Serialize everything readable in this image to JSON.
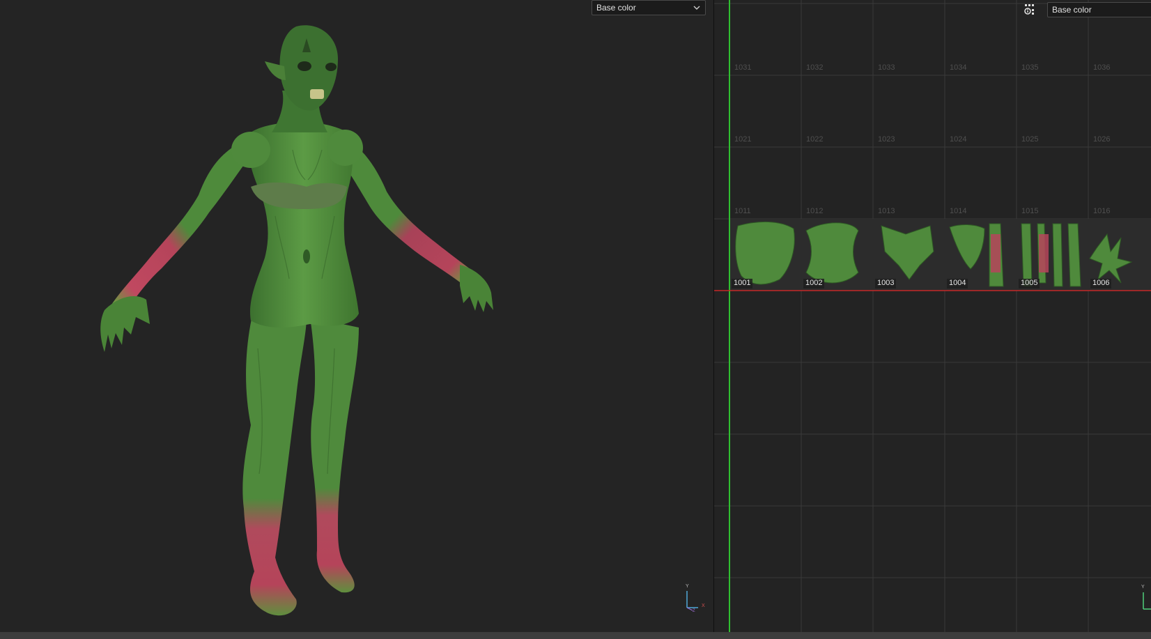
{
  "viewport3d": {
    "channel_select": {
      "value": "Base color"
    },
    "axis_gizmo": {
      "y_label": "Y",
      "x_label": "X",
      "z_label": "Z"
    }
  },
  "uv_view": {
    "channel_select": {
      "value": "Base color"
    },
    "info_icon": "viewer-settings-icon",
    "axis_gizmo": {
      "y_label": "Y"
    },
    "ghost_tiles": [
      "1031",
      "1032",
      "1033",
      "1034",
      "1035",
      "1036",
      "1021",
      "1022",
      "1023",
      "1024",
      "1025",
      "1026",
      "1011",
      "1012",
      "1013",
      "1014",
      "1015",
      "1016"
    ],
    "active_tiles": [
      "1001",
      "1002",
      "1003",
      "1004",
      "1005",
      "1006"
    ]
  },
  "colors": {
    "background": "#232323",
    "grid_line": "#3a3a3a",
    "v_axis": "#2fbf2f",
    "u_axis": "#c62828",
    "skin_green": "#4f8a3c",
    "muscle_red": "#b5445a"
  }
}
